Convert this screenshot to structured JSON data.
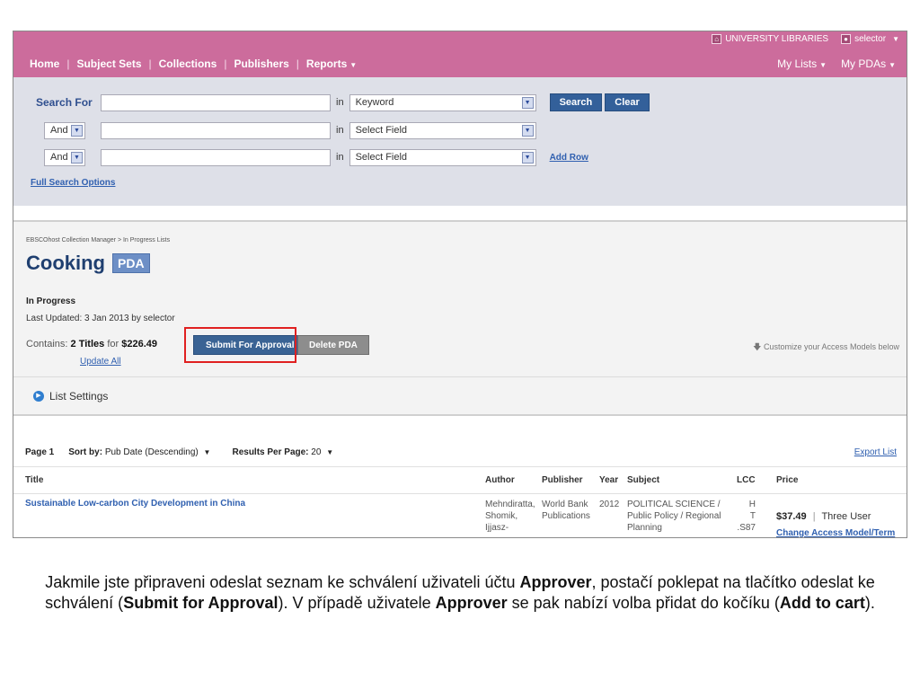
{
  "topbar": {
    "institution": "UNIVERSITY LIBRARIES",
    "user": "selector",
    "nav": [
      "Home",
      "Subject Sets",
      "Collections",
      "Publishers",
      "Reports"
    ],
    "nav_right": [
      "My Lists",
      "My PDAs"
    ],
    "accent": "#cc6c9c"
  },
  "search": {
    "label": "Search For",
    "in_label": "in",
    "rows": [
      {
        "field": "Keyword"
      },
      {
        "operator": "And",
        "field": "Select Field"
      },
      {
        "operator": "And",
        "field": "Select Field"
      }
    ],
    "search_button": "Search",
    "clear_button": "Clear",
    "add_row": "Add Row",
    "full_options": "Full Search Options"
  },
  "list": {
    "breadcrumb": "EBSCOhost Collection Manager  >  In Progress Lists",
    "title": "Cooking",
    "badge": "PDA",
    "status": "In Progress",
    "last_updated": "Last Updated: 3 Jan 2013 by selector",
    "contains_label": "Contains:",
    "titles_count": "2 Titles",
    "for_label": "for",
    "total": "$226.49",
    "update_all": "Update All",
    "submit_button": "Submit For Approval",
    "delete_button": "Delete PDA",
    "customize": "Customize your Access Models below",
    "settings": "List Settings"
  },
  "results": {
    "page": "Page 1",
    "sort_label": "Sort by:",
    "sort_value": "Pub Date (Descending)",
    "per_page_label": "Results Per Page:",
    "per_page_value": "20",
    "export": "Export List",
    "columns": [
      "Title",
      "Author",
      "Publisher",
      "Year",
      "Subject",
      "LCC",
      "Price"
    ],
    "rows": [
      {
        "title": "Sustainable Low-carbon City Development in China",
        "author": [
          "Mehndiratta,",
          "Shomik,",
          "Ijjasz-"
        ],
        "publisher": [
          "World Bank",
          "Publications"
        ],
        "year": "2012",
        "subject": [
          "POLITICAL SCIENCE /",
          "Public Policy / Regional",
          "Planning"
        ],
        "lcc": [
          "H",
          "T",
          ".S87"
        ],
        "price": "$37.49",
        "model": "Three User",
        "change": "Change Access Model/Term"
      }
    ]
  },
  "caption": {
    "p1": "Jakmile jste připraveni odeslat seznam ke schválení uživateli účtu ",
    "b1": "Approver",
    "p2": ", postačí poklepat na tlačítko odeslat ke schválení (",
    "b2": "Submit for Approval",
    "p3": "). V případě uživatele ",
    "b3": "Approver",
    "p4": " se pak nabízí volba přidat do kočíku (",
    "b4": "Add to cart",
    "p5": ")."
  }
}
